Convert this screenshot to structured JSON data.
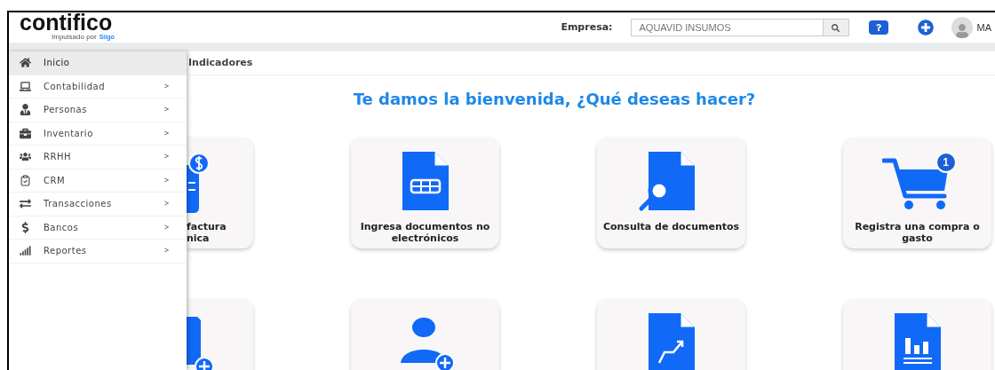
{
  "header": {
    "logo": "contifico",
    "tagline": "Impulsado por",
    "brand": "Siigo",
    "company_label": "Empresa:",
    "company_value": "AQUAVID INSUMOS",
    "user": "MA"
  },
  "sidebar": {
    "items": [
      {
        "label": "Inicio",
        "selected": true
      },
      {
        "label": "Contabilidad",
        "selected": false,
        "arrow": ">"
      },
      {
        "label": "Personas",
        "selected": false,
        "arrow": ">"
      },
      {
        "label": "Inventario",
        "selected": false,
        "arrow": ">"
      },
      {
        "label": "RRHH",
        "selected": false,
        "arrow": ">"
      },
      {
        "label": "CRM",
        "selected": false,
        "arrow": ">"
      },
      {
        "label": "Transacciones",
        "selected": false,
        "arrow": ">"
      },
      {
        "label": "Bancos",
        "selected": false,
        "arrow": ">"
      },
      {
        "label": "Reportes",
        "selected": false,
        "arrow": ">"
      }
    ]
  },
  "tab": "Indicadores",
  "title": "Te damos la bienvenida, ¿Qué deseas hacer?",
  "card_rows": [
    [
      {
        "kind": "partial",
        "lines": [
          "factura",
          "nica"
        ]
      },
      {
        "kind": "full",
        "lines": [
          "Ingresa documentos no",
          "electrónicos"
        ]
      },
      {
        "kind": "full",
        "lines": [
          "Consulta de documentos"
        ]
      },
      {
        "kind": "full",
        "lines": [
          "Registra una compra o",
          "gasto"
        ],
        "badge": "1"
      }
    ],
    [
      {
        "kind": "partial"
      },
      {
        "kind": "full"
      },
      {
        "kind": "full"
      },
      {
        "kind": "full"
      }
    ]
  ]
}
